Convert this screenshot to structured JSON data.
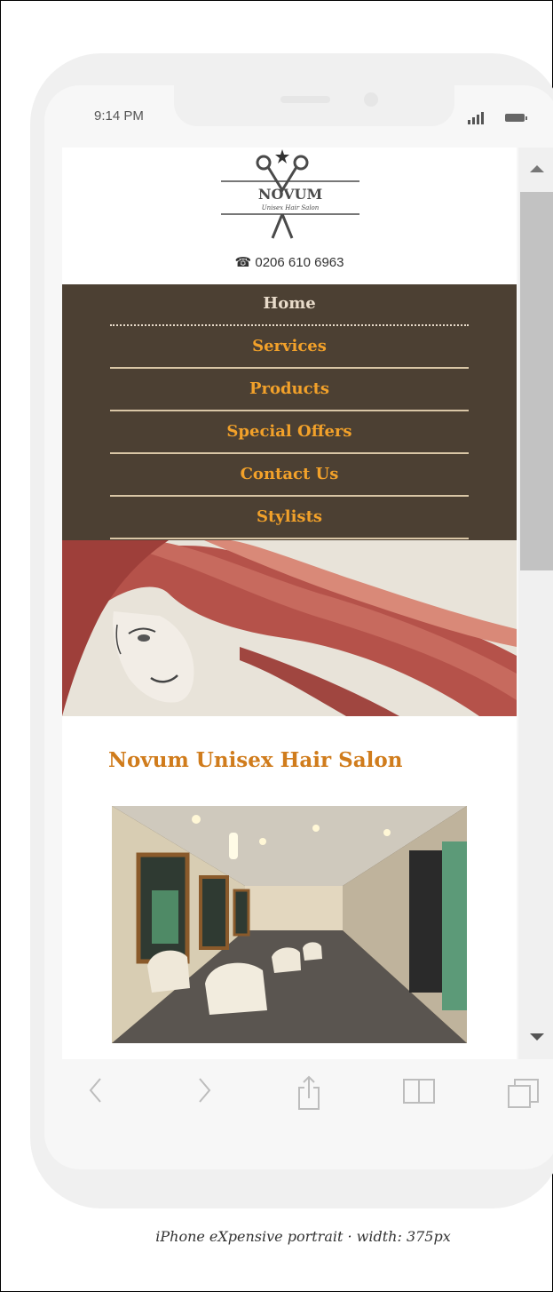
{
  "status_bar": {
    "time": "9:14 PM"
  },
  "site": {
    "logo_name": "NOVUM",
    "logo_tagline": "Unisex Hair Salon",
    "phone": "0206 610 6963",
    "nav": [
      {
        "label": "Home",
        "active": true
      },
      {
        "label": "Services",
        "active": false
      },
      {
        "label": "Products",
        "active": false
      },
      {
        "label": "Special Offers",
        "active": false
      },
      {
        "label": "Contact Us",
        "active": false
      },
      {
        "label": "Stylists",
        "active": false
      }
    ],
    "heading": "Novum Unisex Hair Salon"
  },
  "colors": {
    "nav_bg": "#4c4033",
    "nav_link": "#f2a12a",
    "nav_active": "#e9dccb",
    "heading": "#d07c1c",
    "hero_hair": "#b5524a"
  },
  "toolbar": {
    "icons": [
      "back-icon",
      "forward-icon",
      "share-icon",
      "bookmarks-icon",
      "tabs-icon"
    ]
  },
  "caption": "iPhone eXpensive portrait · width: 375px"
}
